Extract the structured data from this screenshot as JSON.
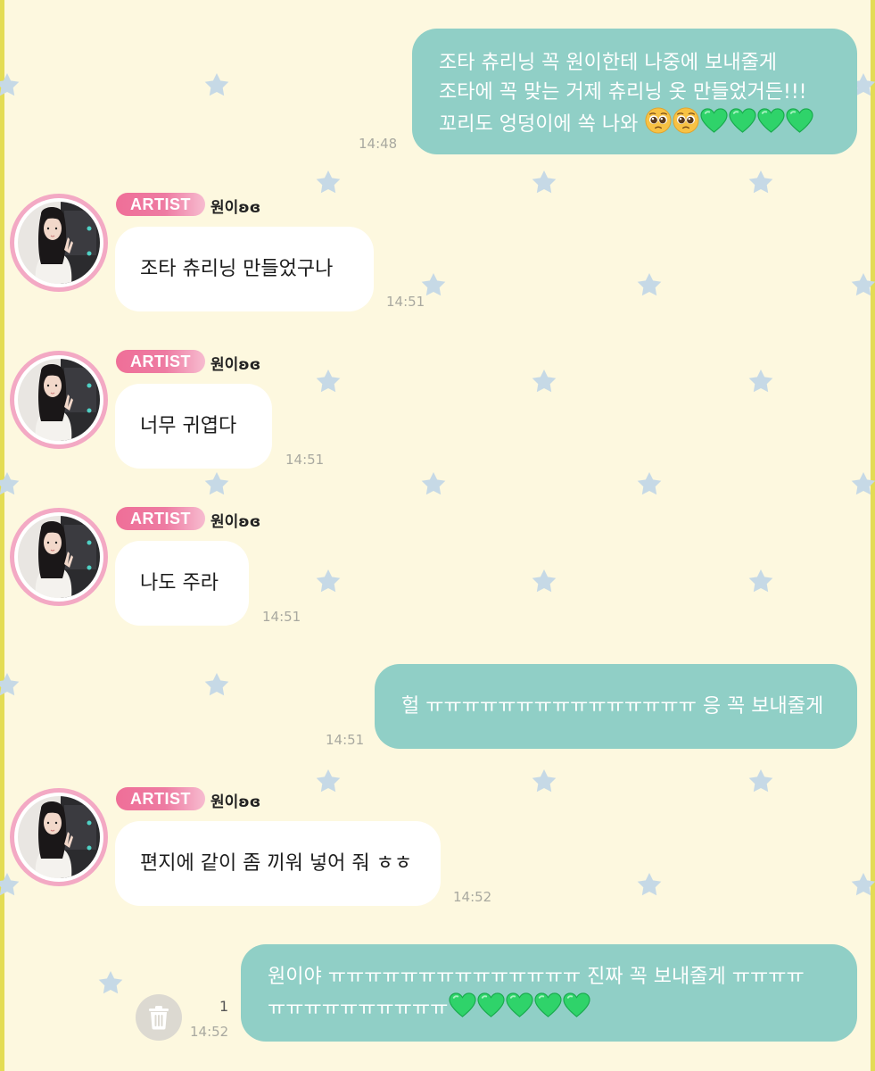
{
  "colors": {
    "background": "#fdf8df",
    "outgoing_bubble": "#90cfc6",
    "incoming_bubble": "#ffffff",
    "badge_pink": "#ef6f98",
    "star": "#c6d9e6",
    "heart": "#2fd36a"
  },
  "icons": {
    "heart": "green-heart-icon",
    "pleading_face": "pleading-face-icon",
    "trash": "trash-icon"
  },
  "messages": [
    {
      "side": "out",
      "lines": [
        "조타 츄리닝 꼭 원이한테 나중에 보내줄게",
        "조타에 꼭 맞는 거제 츄리닝 옷 만들었거든!!!",
        "꼬리도 엉덩이에 쏙 나와"
      ],
      "time": "14:48"
    },
    {
      "side": "in",
      "badge": "ARTIST",
      "sender": "원이ʚɞ",
      "text": "조타 츄리닝 만들었구나",
      "time": "14:51"
    },
    {
      "side": "in",
      "badge": "ARTIST",
      "sender": "원이ʚɞ",
      "text": "너무 귀엽다",
      "time": "14:51"
    },
    {
      "side": "in",
      "badge": "ARTIST",
      "sender": "원이ʚɞ",
      "text": "나도 주라",
      "time": "14:51"
    },
    {
      "side": "out",
      "lines": [
        "헐 ㅠㅠㅠㅠㅠㅠㅠㅠㅠㅠㅠㅠㅠㅠㅠ 응 꼭 보내줄게"
      ],
      "time": "14:51"
    },
    {
      "side": "in",
      "badge": "ARTIST",
      "sender": "원이ʚɞ",
      "text": "편지에 같이 좀 끼워 넣어 줘 ㅎㅎ",
      "time": "14:52"
    },
    {
      "side": "out",
      "lines": [
        "원이야 ㅠㅠㅠㅠㅠㅠㅠㅠㅠㅠㅠㅠㅠㅠ 진짜 꼭 보내줄게 ㅠㅠㅠㅠ",
        "ㅠㅠㅠㅠㅠㅠㅠㅠㅠㅠ"
      ],
      "time": "14:52",
      "unread_count": "1"
    }
  ]
}
